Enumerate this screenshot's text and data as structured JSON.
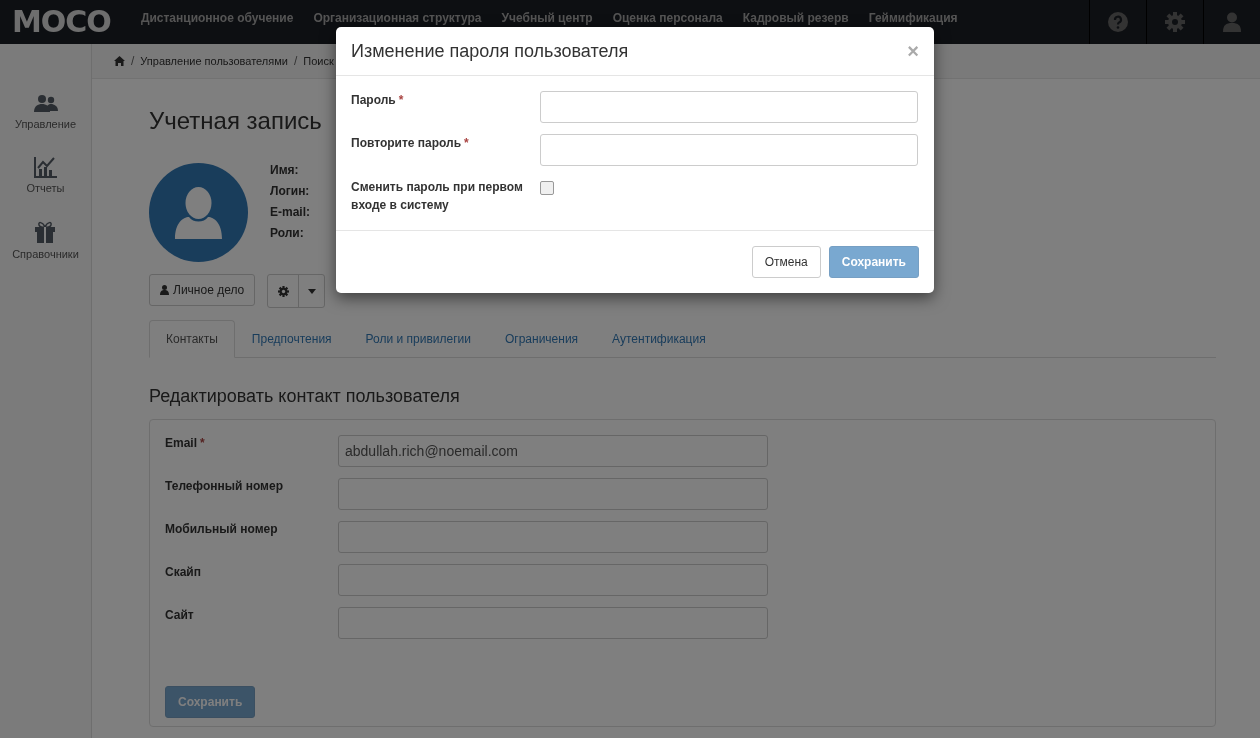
{
  "nav": {
    "logo": "MOCO",
    "items": [
      "Дистанционное обучение",
      "Организационная структура",
      "Учебный центр",
      "Оценка персонала",
      "Кадровый резерв",
      "Геймификация"
    ]
  },
  "sidebar": {
    "items": [
      {
        "label": "Управление",
        "kind": "users"
      },
      {
        "label": "Отчеты",
        "kind": "chart"
      },
      {
        "label": "Справочники",
        "kind": "gift"
      }
    ]
  },
  "breadcrumb": {
    "separator": "/",
    "items": [
      "Управление пользователями",
      "Поиск"
    ]
  },
  "profile": {
    "title": "Учетная запись",
    "fields": [
      "Имя:",
      "Логин:",
      "E-mail:",
      "Роли:"
    ],
    "personal_file_button": "Личное дело"
  },
  "tabs": [
    {
      "label": "Контакты",
      "selected": true
    },
    {
      "label": "Предпочтения",
      "selected": false
    },
    {
      "label": "Роли и привилегии",
      "selected": false
    },
    {
      "label": "Ограничения",
      "selected": false
    },
    {
      "label": "Аутентификация",
      "selected": false
    }
  ],
  "contact_form": {
    "title": "Редактировать контакт пользователя",
    "fields": [
      {
        "label": "Email",
        "required_mark": "*",
        "value": "abdullah.rich@noemail.com"
      },
      {
        "label": "Телефонный номер"
      },
      {
        "label": "Мобильный номер"
      },
      {
        "label": "Скайп"
      },
      {
        "label": "Сайт"
      }
    ],
    "save_button": {
      "label": "Сохранить",
      "disabled": true
    }
  },
  "modal": {
    "title": "Изменение пароля пользователя",
    "close": "×",
    "fields": [
      {
        "label": "Пароль",
        "required_mark": "*"
      },
      {
        "label": "Повторите пароль",
        "required_mark": "*"
      }
    ],
    "checkbox": {
      "label": "Сменить пароль при первом входе в систему",
      "checked": false
    },
    "buttons": [
      {
        "label": "Отмена",
        "kind": "default",
        "disabled": false
      },
      {
        "label": "Сохранить",
        "kind": "primary",
        "disabled": true
      }
    ]
  }
}
